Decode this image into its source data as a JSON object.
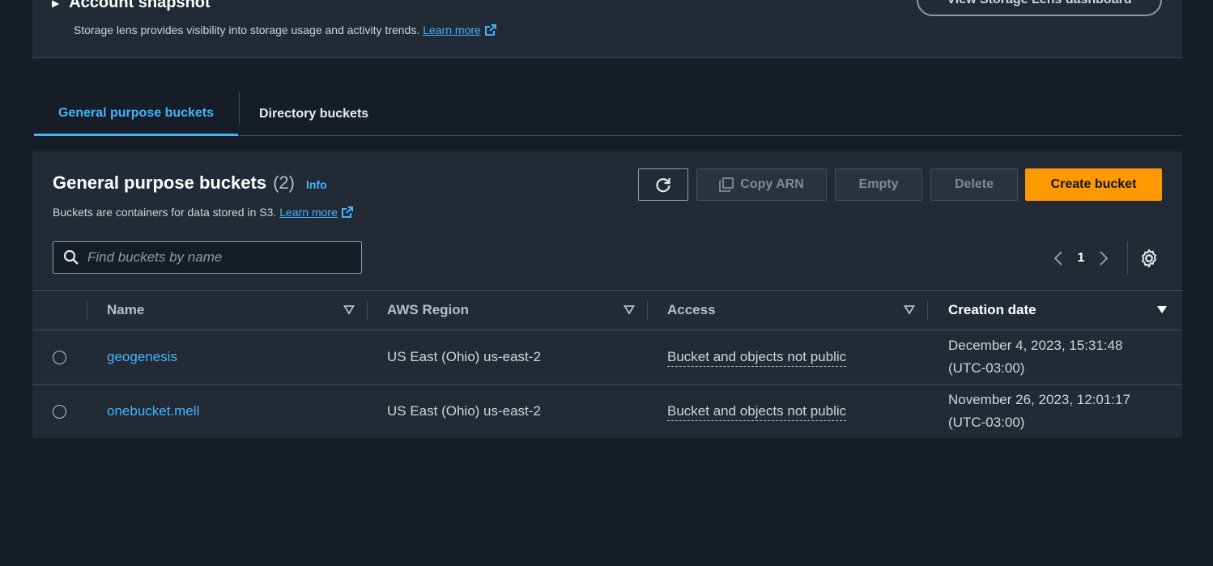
{
  "snapshot": {
    "title": "Account snapshot",
    "description": "Storage lens provides visibility into storage usage and activity trends.",
    "learn_more": "Learn more",
    "lens_button": "View Storage Lens dashboard"
  },
  "tabs": [
    {
      "label": "General purpose buckets"
    },
    {
      "label": "Directory buckets"
    }
  ],
  "container": {
    "title": "General purpose buckets",
    "count": "(2)",
    "info": "Info",
    "description": "Buckets are containers for data stored in S3.",
    "learn_more": "Learn more"
  },
  "actions": {
    "copy_arn": "Copy ARN",
    "empty": "Empty",
    "delete": "Delete",
    "create": "Create bucket"
  },
  "search": {
    "placeholder": "Find buckets by name"
  },
  "pagination": {
    "page": "1"
  },
  "table": {
    "headers": [
      "Name",
      "AWS Region",
      "Access",
      "Creation date"
    ],
    "rows": [
      {
        "name": "geogenesis",
        "region": "US East (Ohio) us-east-2",
        "access": "Bucket and objects not public",
        "date1": "December 4, 2023, 15:31:48",
        "date2": "(UTC-03:00)"
      },
      {
        "name": "onebucket.mell",
        "region": "US East (Ohio) us-east-2",
        "access": "Bucket and objects not public",
        "date1": "November 26, 2023, 12:01:17",
        "date2": "(UTC-03:00)"
      }
    ]
  },
  "colors": {
    "background": "#161d26",
    "panel": "#222a35",
    "link": "#42b4ff",
    "primary": "#ff9900"
  }
}
